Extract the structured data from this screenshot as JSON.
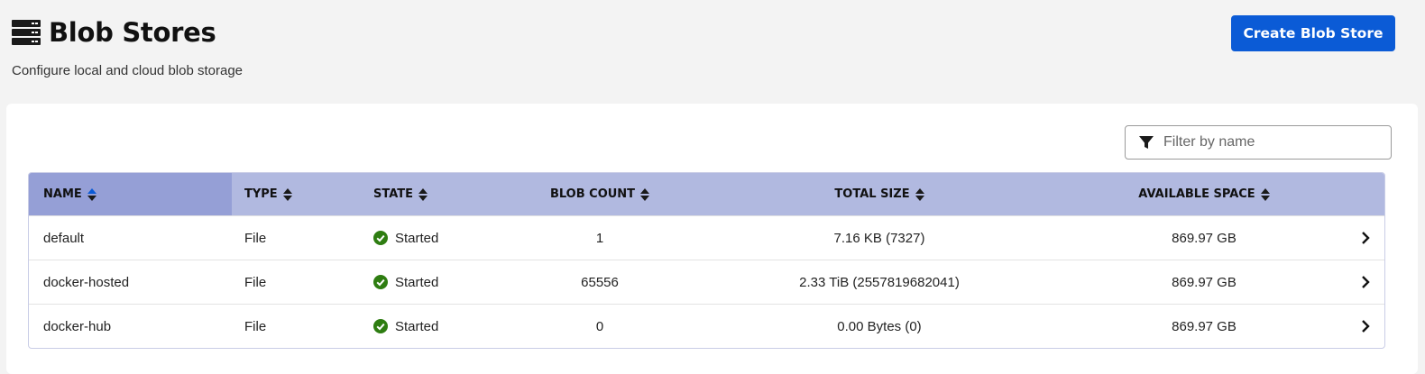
{
  "header": {
    "title": "Blob Stores",
    "subtitle": "Configure local and cloud blob storage",
    "title_icon": "server-stack-icon",
    "create_button_label": "Create Blob Store"
  },
  "filter": {
    "placeholder": "Filter by name",
    "value": "",
    "icon": "filter-icon"
  },
  "table": {
    "columns": [
      {
        "label": "NAME",
        "sort": "ascending"
      },
      {
        "label": "TYPE",
        "sort": "none"
      },
      {
        "label": "STATE",
        "sort": "none"
      },
      {
        "label": "BLOB COUNT",
        "sort": "none"
      },
      {
        "label": "TOTAL SIZE",
        "sort": "none"
      },
      {
        "label": "AVAILABLE SPACE",
        "sort": "none"
      }
    ],
    "rows": [
      {
        "name": "default",
        "type": "File",
        "state": "Started",
        "blob_count": "1",
        "total_size": "7.16 KB (7327)",
        "available_space": "869.97 GB"
      },
      {
        "name": "docker-hosted",
        "type": "File",
        "state": "Started",
        "blob_count": "65556",
        "total_size": "2.33 TiB (2557819682041)",
        "available_space": "869.97 GB"
      },
      {
        "name": "docker-hub",
        "type": "File",
        "state": "Started",
        "blob_count": "0",
        "total_size": "0.00 Bytes (0)",
        "available_space": "869.97 GB"
      }
    ]
  },
  "colors": {
    "accent": "#0b5bd6",
    "header_bg": "#b1b9e0",
    "sorted_header_bg": "#959fd6",
    "status_ok": "#2e7d11",
    "page_bg": "#f3f3f3"
  }
}
